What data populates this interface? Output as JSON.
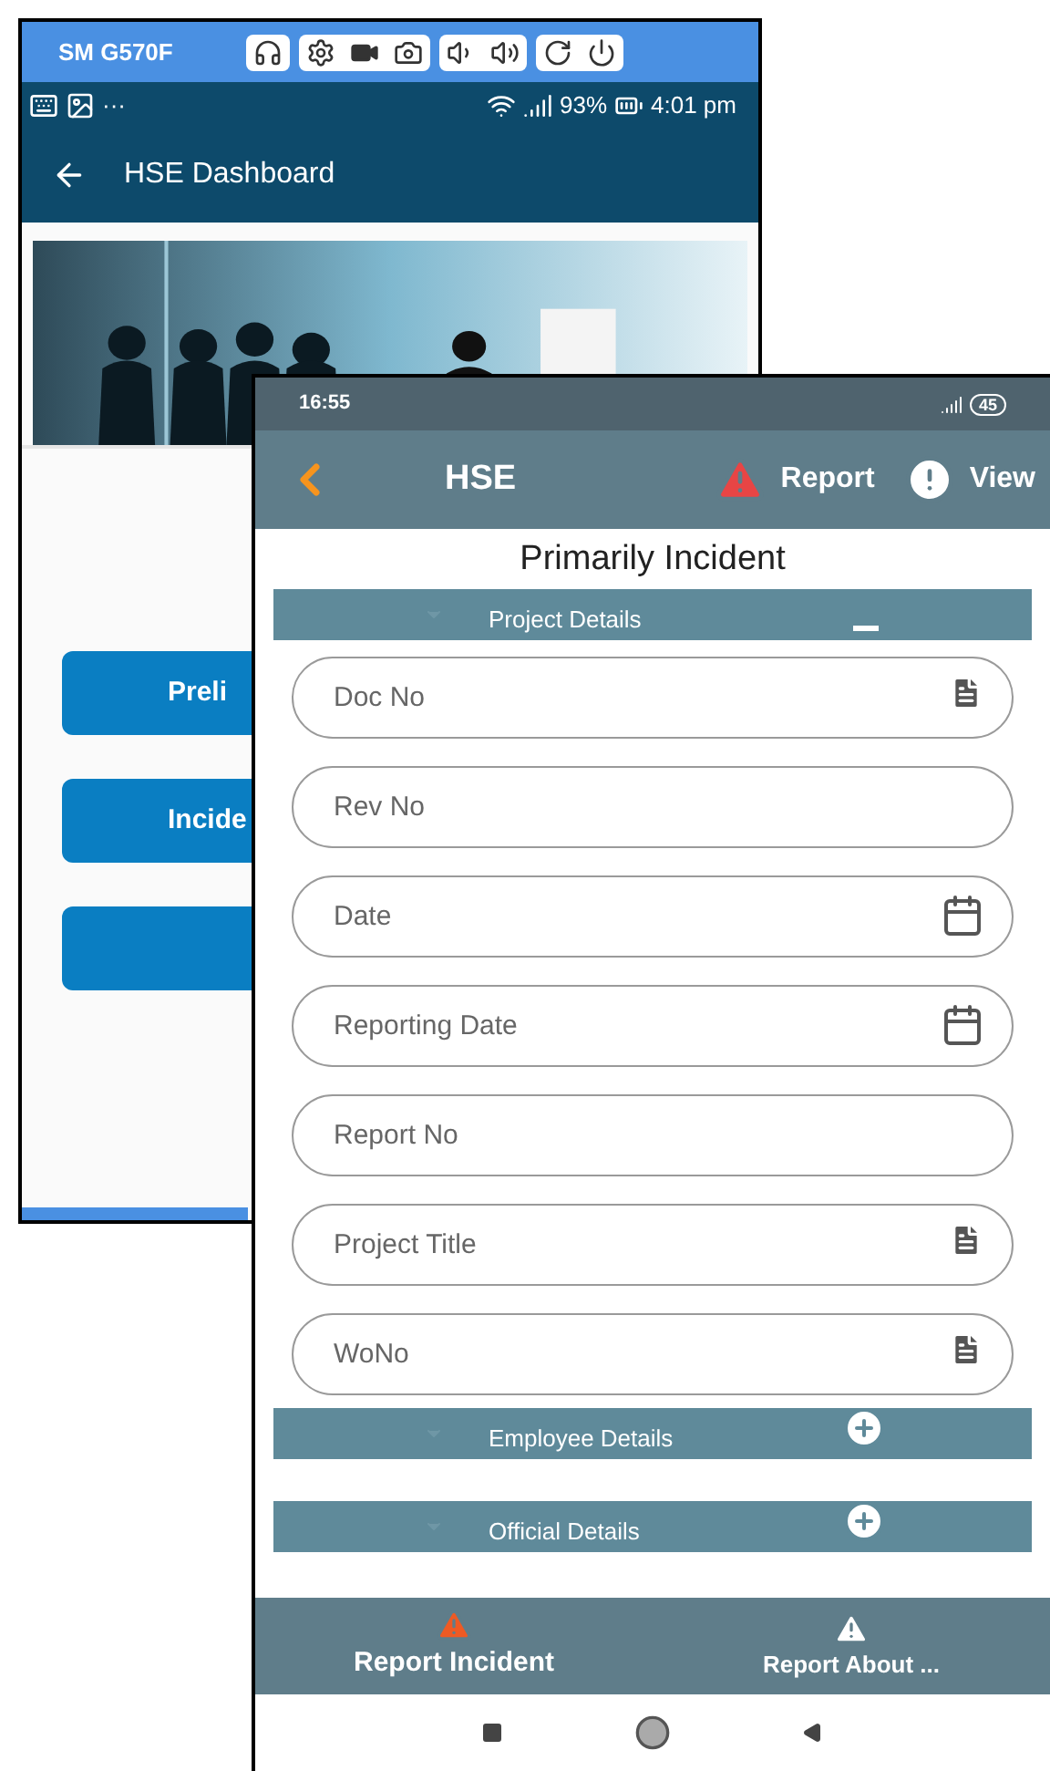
{
  "back_window": {
    "device_name": "SM G570F",
    "status_bar": {
      "more": "···",
      "battery": "93%",
      "time": "4:01 pm"
    },
    "app_bar": {
      "title": "HSE Dashboard"
    },
    "buttons": [
      {
        "kind": "labeled",
        "label": "Preli"
      },
      {
        "kind": "labeled",
        "label": "Incide"
      },
      {
        "kind": "blank"
      }
    ]
  },
  "front_window": {
    "status_bar": {
      "time": "16:55",
      "battery": "45"
    },
    "app_bar": {
      "title": "HSE",
      "actions": [
        {
          "kind": "warning",
          "label": "Report"
        },
        {
          "kind": "info",
          "label": "View"
        }
      ]
    },
    "page_title": "Primarily Incident",
    "sections": [
      {
        "title": "Project Details",
        "expanded": true,
        "fields": [
          {
            "placeholder": "Doc No",
            "kind": "document"
          },
          {
            "placeholder": "Rev No",
            "kind": "plain"
          },
          {
            "placeholder": "Date",
            "kind": "calendar"
          },
          {
            "placeholder": "Reporting Date",
            "kind": "calendar"
          },
          {
            "placeholder": "Report No",
            "kind": "plain"
          },
          {
            "placeholder": "Project Title",
            "kind": "document"
          },
          {
            "placeholder": "WoNo",
            "kind": "document"
          }
        ]
      },
      {
        "title": "Employee Details",
        "expanded": false
      },
      {
        "title": "Official Details",
        "expanded": false
      }
    ],
    "bottom_nav": [
      {
        "label": "Report Incident",
        "selected": true
      },
      {
        "label": "Report About ...",
        "selected": false
      }
    ]
  }
}
